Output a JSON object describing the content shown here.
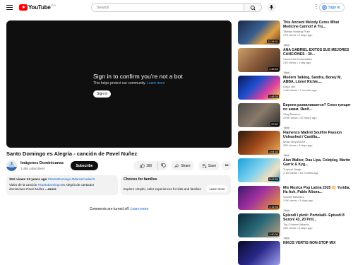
{
  "header": {
    "logo_text": "YouTube",
    "logo_country": "CO",
    "search_placeholder": "Search",
    "signin_label": "Sign in"
  },
  "player": {
    "heading": "Sign in to confirm you’re not a bot",
    "subtext": "This helps protect our community.",
    "learn_more": "Learn more",
    "signin_button": "Sign in"
  },
  "video": {
    "title": "Santo Domingo es Alegría - canción de Pavel Nuñez",
    "channel": "Imágenes Dominicanas",
    "subscribers": "1.45K subscribers",
    "subscribe_label": "Subscribe",
    "likes": "166",
    "share_label": "Share",
    "save_label": "Save"
  },
  "description": {
    "stats": "31K views  13 years ago",
    "hashtags": "#SantoDomingo #MarcaCiudad #",
    "line2_pre": "Video de la canción ",
    "line2_tag": "#SantoDomingo",
    "line2_post": " es Alegría de cantautor",
    "line3": "dominicano Pavel Nuñez ",
    "more": "...more"
  },
  "families": {
    "title": "Choices for families",
    "text": "Explore simpler, safer experiences for kids and families",
    "button": "Learn more"
  },
  "comments": {
    "text": "Comments are turned off.",
    "link": "Learn more"
  },
  "recommendations": [
    {
      "title": "This Ancient Melody Cures What Medicine Cannot! A Tru...",
      "channel": "Tibetan Healing Flute",
      "meta": "27K views • 2 days ago",
      "badge": "New",
      "duration": "11:34:01"
    },
    {
      "title": "ANA GABRIEL ÉXITOS SUS MEJORES CANCIONES - 30...",
      "channel": "Canciones Inolvidables",
      "meta": "21K views • 1 day ago",
      "badge": "New",
      "duration": "1:36:53"
    },
    {
      "title": "Modern Talking, Sandra, Boney M, ABBA, Lionel Richie,...",
      "channel": "Disco Mix",
      "meta": "1.4M views • 2 months ago",
      "badge": "",
      "duration": "1:46:39"
    },
    {
      "title": "Европа разваливается? Союз трещит по швам. Якоб...",
      "channel": "Oleg Baranov",
      "meta": "225K views • 20 hours ago",
      "badge": "New",
      "duration": "29:52"
    },
    {
      "title": "Flamenco Madrid Soulfire Passion Unleashed / Castilia...",
      "channel": "Music Beyond Art",
      "meta": "38K views • 4 days ago",
      "badge": "New",
      "duration": "1:04:33"
    },
    {
      "title": "Alan Walker, Dua Lipa, Coldplay, Martin Garrix & Kyg...",
      "channel": "Tropical Magic",
      "meta": "3.1M views • 10 months ago",
      "badge": "",
      "duration": "2:47:52"
    },
    {
      "title": "Mix Musica Pop Latina 2025 💥 Yuridia, Ha Ash, Pablo Albora...",
      "channel": "Sunset Melodies",
      "meta": "3.5K views • 3 days ago",
      "badge": "New",
      "duration": "1:11:46"
    },
    {
      "title": "Episodi i plotë: Portokalli- Episodi 8 Sezoni 43, 20 Prill...",
      "channel": "Top Channel Albania",
      "meta": "33K views • 6 days ago",
      "badge": "New",
      "duration": "1:40:34"
    },
    {
      "title": "NIKOS VERTIS NON-STOP MIX",
      "channel": "",
      "meta": "",
      "badge": "",
      "duration": ""
    }
  ]
}
